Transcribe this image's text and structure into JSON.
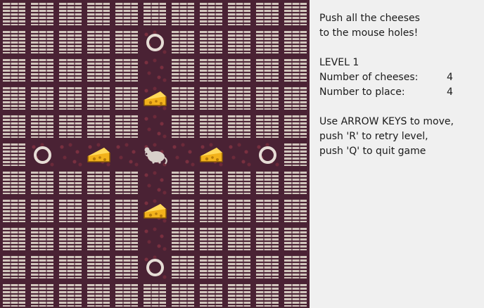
{
  "game": {
    "title": "Push all the cheeses",
    "subtitle": "to the mouse holes!",
    "level_label": "LEVEL 1",
    "cheeses_label": "Number of cheeses:",
    "cheeses_value": "4",
    "to_place_label": "Number to place:",
    "to_place_value": "4",
    "instructions": [
      "Use ARROW KEYS to move,",
      "push 'R' to retry level,",
      "push 'Q' to quit game"
    ]
  },
  "board": {
    "columns": 11,
    "rows": 11,
    "map": [
      "WWWWWWWWWWW",
      "WWWWWOWWWWW",
      "WWWWW.WWWWW",
      "WWWWWCWWWWW",
      "WWWWW.WWWWW",
      "WO.C.M.C.OW",
      "WWWWW.WWWWW",
      "WWWWWCWWWWW",
      "WWWWW.WWWWW",
      "WWWWWOWWWWW",
      "WWWWWWWWWWW"
    ],
    "legend": {
      "W": "wall",
      "O": "mouse-hole",
      ".": "floor",
      "C": "cheese",
      "M": "mouse"
    },
    "colors": {
      "wall_brick": "#d2c6bd",
      "mortar": "#4a2234",
      "cheese": "#f2b21b",
      "hole_ring": "#e6ddd6",
      "mouse": "#d8d0ca"
    }
  }
}
